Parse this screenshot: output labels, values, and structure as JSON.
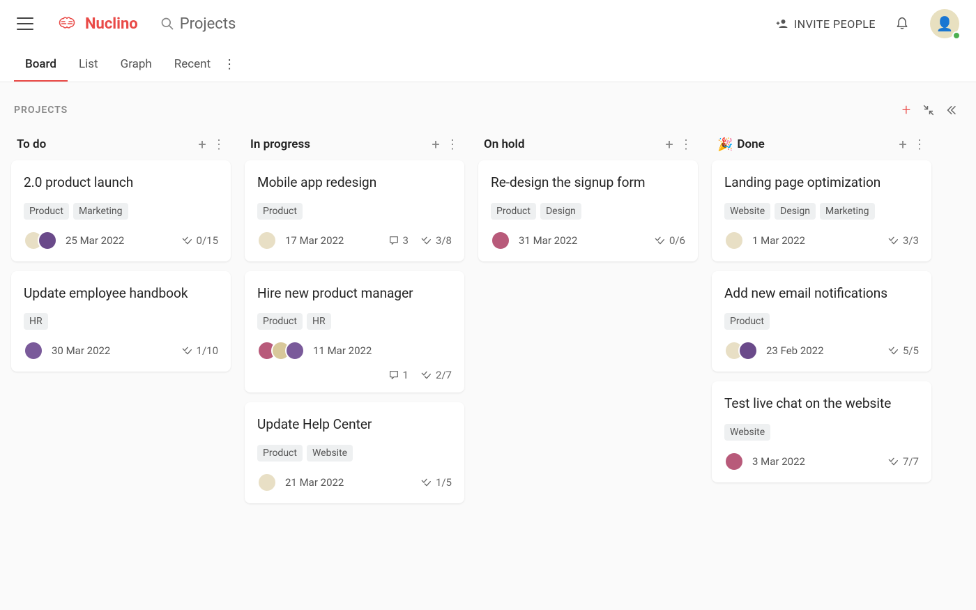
{
  "brand": "Nuclino",
  "search_placeholder": "Projects",
  "invite_label": "INVITE PEOPLE",
  "tabs": [
    "Board",
    "List",
    "Graph",
    "Recent"
  ],
  "active_tab": "Board",
  "board": {
    "title": "PROJECTS",
    "columns": [
      {
        "name": "To do",
        "emoji": "",
        "cards": [
          {
            "title": "2.0 product launch",
            "tags": [
              "Product",
              "Marketing"
            ],
            "avatars": [
              "a1",
              "a2"
            ],
            "date": "25 Mar 2022",
            "comments": null,
            "checklist": "0/15"
          },
          {
            "title": "Update employee handbook",
            "tags": [
              "HR"
            ],
            "avatars": [
              "a5"
            ],
            "date": "30 Mar 2022",
            "comments": null,
            "checklist": "1/10"
          }
        ]
      },
      {
        "name": "In progress",
        "emoji": "",
        "cards": [
          {
            "title": "Mobile app redesign",
            "tags": [
              "Product"
            ],
            "avatars": [
              "a1"
            ],
            "date": "17 Mar 2022",
            "comments": "3",
            "checklist": "3/8"
          },
          {
            "title": "Hire new product manager",
            "tags": [
              "Product",
              "HR"
            ],
            "avatars": [
              "a3",
              "a4",
              "a5"
            ],
            "date": "11 Mar 2022",
            "comments": "1",
            "checklist": "2/7",
            "second_row": true
          },
          {
            "title": "Update Help Center",
            "tags": [
              "Product",
              "Website"
            ],
            "avatars": [
              "a1"
            ],
            "date": "21 Mar 2022",
            "comments": null,
            "checklist": "1/5"
          }
        ]
      },
      {
        "name": "On hold",
        "emoji": "",
        "cards": [
          {
            "title": "Re-design the signup form",
            "tags": [
              "Product",
              "Design"
            ],
            "avatars": [
              "a3"
            ],
            "date": "31 Mar 2022",
            "comments": null,
            "checklist": "0/6"
          }
        ]
      },
      {
        "name": "Done",
        "emoji": "🎉",
        "cards": [
          {
            "title": "Landing page optimization",
            "tags": [
              "Website",
              "Design",
              "Marketing"
            ],
            "avatars": [
              "a1"
            ],
            "date": "1 Mar 2022",
            "comments": null,
            "checklist": "3/3"
          },
          {
            "title": "Add new email notifications",
            "tags": [
              "Product"
            ],
            "avatars": [
              "a1",
              "a2"
            ],
            "date": "23 Feb 2022",
            "comments": null,
            "checklist": "5/5"
          },
          {
            "title": "Test live chat on the website",
            "tags": [
              "Website"
            ],
            "avatars": [
              "a3"
            ],
            "date": "3 Mar 2022",
            "comments": null,
            "checklist": "7/7"
          }
        ]
      }
    ]
  }
}
